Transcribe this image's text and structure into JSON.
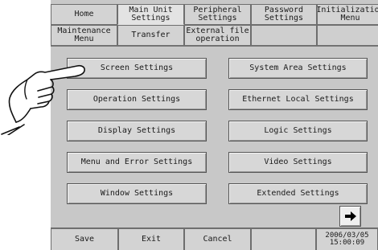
{
  "tabs_row1": [
    "Home",
    "Main Unit\nSettings",
    "Peripheral\nSettings",
    "Password\nSettings",
    "Initialization\nMenu"
  ],
  "tabs_row2": [
    "Maintenance\nMenu",
    "Transfer",
    "External file\noperation",
    "",
    ""
  ],
  "left_buttons": [
    "Screen Settings",
    "Operation Settings",
    "Display Settings",
    "Menu and Error Settings",
    "Window Settings"
  ],
  "right_buttons": [
    "System Area Settings",
    "Ethernet Local Settings",
    "Logic Settings",
    "Video Settings",
    "Extended Settings"
  ],
  "footer": {
    "save": "Save",
    "exit": "Exit",
    "cancel": "Cancel",
    "date": "2006/03/05",
    "time": "15:00:09"
  },
  "icons": {
    "next_page": "arrow-right-icon",
    "pointer": "pointing-hand-icon"
  },
  "colors": {
    "panel_bg": "#c8c8c8",
    "button_bg": "#d7d7d7",
    "border": "#555555"
  }
}
